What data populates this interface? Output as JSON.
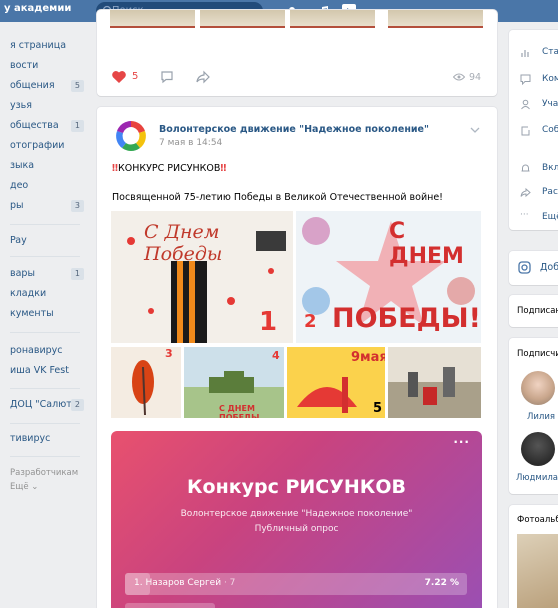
{
  "header": {
    "brand": "у академии",
    "search_placeholder": "Поиск"
  },
  "sidebar": {
    "items": [
      {
        "label": "я страница",
        "count": ""
      },
      {
        "label": "вости",
        "count": ""
      },
      {
        "label": "общения",
        "count": "5"
      },
      {
        "label": "узья",
        "count": ""
      },
      {
        "label": "обществa",
        "count": "1"
      },
      {
        "label": "отографии",
        "count": ""
      },
      {
        "label": "зыка",
        "count": ""
      },
      {
        "label": "део",
        "count": ""
      },
      {
        "label": "ры",
        "count": "3"
      }
    ],
    "pay": "Pay",
    "items2": [
      {
        "label": "вары",
        "count": "1"
      },
      {
        "label": "кладки",
        "count": ""
      },
      {
        "label": "кументы",
        "count": ""
      }
    ],
    "items3": [
      {
        "label": "ронавирус",
        "count": ""
      },
      {
        "label": "иша VK Fest",
        "count": ""
      }
    ],
    "items4": [
      {
        "label": "ДОЦ \"Салют\"",
        "count": "2"
      }
    ],
    "items5": [
      {
        "label": "тивирус",
        "count": ""
      }
    ],
    "footer1": "Разработчикам",
    "footer2": "Ещё ⌄"
  },
  "prev_post": {
    "likes": "5",
    "views": "94"
  },
  "post": {
    "author": "Волонтерское движение \"Надежное поколение\"",
    "date": "7 мая в 14:54",
    "line1": "КОНКУРС РИСУНКОВ",
    "line2": "Посвященной 75-летию Победы в Великой Отечественной войне!",
    "photos": {
      "p1_text": "С Днем Победы",
      "p1_num": "1",
      "p2_text": "С ДНЕМ",
      "p2_text2": "ПОБЕДЫ!",
      "p2_num": "2",
      "p3_num": "3",
      "p4_text": "С ДНЕМ ПОБЕДЫ",
      "p4_num": "4",
      "p5_text": "9мая",
      "p5_num": "5"
    }
  },
  "poll": {
    "title": "Конкурс РИСУНКОВ",
    "org": "Волонтерское движение \"Надежное поколение\"",
    "type": "Публичный опрос",
    "option1_label": "1. Назаров Сергей",
    "option1_count": "· 7",
    "option1_pct": "7.22 %",
    "option1_fraction": 0.0722
  },
  "right": {
    "menu": [
      "Ста",
      "Ком",
      "Уча",
      "Соб"
    ],
    "menu2": [
      "Вкл",
      "Рас",
      "Ещё"
    ],
    "instagram": "Доб",
    "subscribed": "Подписан",
    "subscribers_head": "Подписчи",
    "people": [
      "Лилия",
      "Людмила"
    ],
    "albums": "Фотоальб"
  },
  "colors": {
    "vk_blue": "#4a76a8",
    "link": "#2a5885",
    "like_red": "#e64646",
    "poll_from": "#e8516e",
    "poll_to": "#9b4fb2"
  }
}
